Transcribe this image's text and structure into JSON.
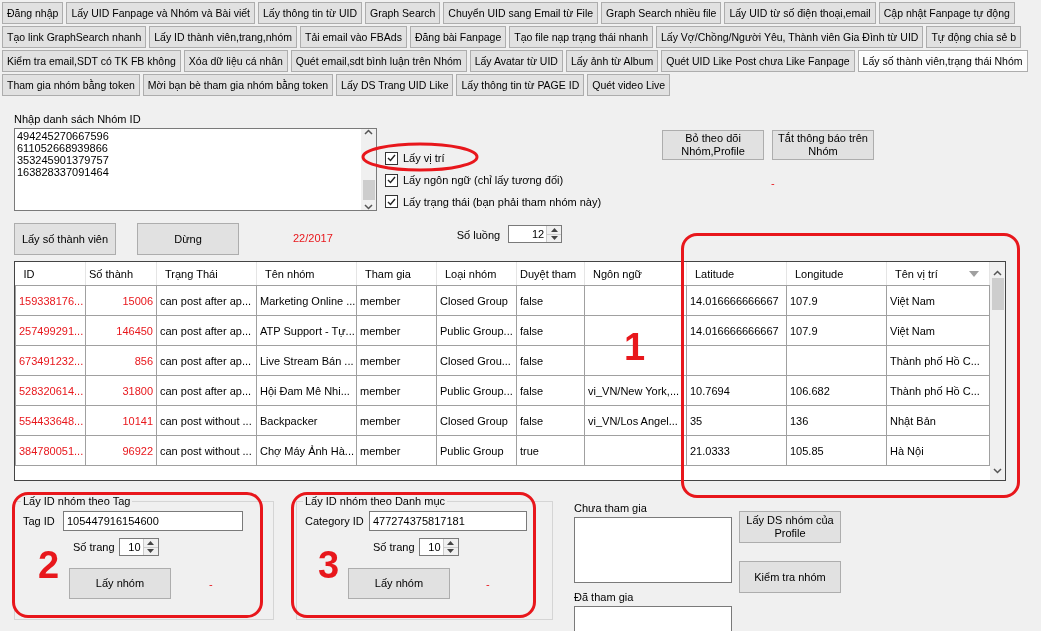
{
  "tab_rows": [
    [
      {
        "label": "Đăng nhập",
        "selected": false
      },
      {
        "label": "Lấy UID Fanpage và Nhóm và Bài viết",
        "selected": false
      },
      {
        "label": "Lấy thông tin từ UID",
        "selected": false
      },
      {
        "label": "Graph Search",
        "selected": false
      },
      {
        "label": "Chuyển UID sang Email từ File",
        "selected": false
      },
      {
        "label": "Graph Search nhiều file",
        "selected": false
      },
      {
        "label": "Lấy UID từ số điện thoại,email",
        "selected": false
      },
      {
        "label": "Cập nhật Fanpage tự động",
        "selected": false
      }
    ],
    [
      {
        "label": "Tạo link GraphSearch nhanh",
        "selected": false
      },
      {
        "label": "Lấy ID thành viên,trang,nhóm",
        "selected": false
      },
      {
        "label": "Tải email vào FBAds",
        "selected": false
      },
      {
        "label": "Đăng bài Fanpage",
        "selected": false
      },
      {
        "label": "Tạo file nạp trạng thái nhanh",
        "selected": false
      },
      {
        "label": "Lấy Vợ/Chồng/Người Yêu, Thành viên Gia Đình từ UID",
        "selected": false
      },
      {
        "label": "Tự động chia sẻ b",
        "selected": false
      }
    ],
    [
      {
        "label": "Kiểm tra email,SDT có TK FB không",
        "selected": false
      },
      {
        "label": "Xóa dữ liệu cá nhân",
        "selected": false
      },
      {
        "label": "Quét email,sdt bình luận trên Nhóm",
        "selected": false
      },
      {
        "label": "Lấy Avatar từ UID",
        "selected": false
      },
      {
        "label": "Lấy ảnh từ Album",
        "selected": false
      },
      {
        "label": "Quét UID Like Post chưa Like Fanpage",
        "selected": false
      },
      {
        "label": "Lấy số thành viên,trạng thái Nhóm",
        "selected": true
      }
    ],
    [
      {
        "label": "Tham gia nhóm bằng token",
        "selected": false
      },
      {
        "label": "Mời bạn bè tham gia nhóm bằng token",
        "selected": false
      },
      {
        "label": "Lấy DS Trang UID Like",
        "selected": false
      },
      {
        "label": "Lấy thông tin từ PAGE ID",
        "selected": false
      },
      {
        "label": "Quét video Live",
        "selected": false
      }
    ]
  ],
  "group_ids": {
    "label": "Nhập danh sách Nhóm ID",
    "lines": [
      "494245270667596",
      "611052668939866",
      "353245901379757",
      "163828337091464"
    ]
  },
  "options": [
    {
      "label": "Lấy vị trí",
      "checked": true
    },
    {
      "label": "Lấy ngôn ngữ (chỉ lấy tương đối)",
      "checked": true
    },
    {
      "label": "Lấy trạng thái (bạn phải tham nhóm này)",
      "checked": true
    }
  ],
  "side_buttons": [
    "Bỏ theo dõi Nhóm,Profile",
    "Tắt thông báo trên Nhóm"
  ],
  "side_status": "-",
  "actions": {
    "count_button": "Lấy số thành viên",
    "stop_button": "Dừng",
    "progress": "22/2017",
    "threads_label": "Số luồng",
    "threads": "12"
  },
  "table": {
    "columns": [
      {
        "label": "ID",
        "sorted": false
      },
      {
        "label": "Số thành",
        "sorted": false
      },
      {
        "label": "Trạng Thái",
        "sorted": false
      },
      {
        "label": "Tên nhóm",
        "sorted": false
      },
      {
        "label": "Tham gia",
        "sorted": false
      },
      {
        "label": "Loại nhóm",
        "sorted": false
      },
      {
        "label": "Duyệt tham",
        "sorted": false
      },
      {
        "label": "Ngôn ngữ",
        "sorted": false
      },
      {
        "label": "Latitude",
        "sorted": false
      },
      {
        "label": "Longitude",
        "sorted": false
      },
      {
        "label": "Tên vị trí",
        "sorted": true
      }
    ],
    "rows": [
      [
        "159338176...",
        "15006",
        "can post after ap...",
        "Marketing Online ...",
        "member",
        "Closed Group",
        "false",
        "",
        "14.016666666667",
        "107.9",
        "Việt Nam"
      ],
      [
        "257499291...",
        "146450",
        "can post after ap...",
        "ATP Support - Tự...",
        "member",
        "Public Group...",
        "false",
        "",
        "14.016666666667",
        "107.9",
        "Việt Nam"
      ],
      [
        "673491232...",
        "856",
        "can post after ap...",
        "Live Stream Bán ...",
        "member",
        "Closed Grou...",
        "false",
        "",
        "",
        "",
        "Thành phố Hồ C..."
      ],
      [
        "528320614...",
        "31800",
        "can post after ap...",
        "Hội  Đam Mê Nhi...",
        "member",
        "Public Group...",
        "false",
        "vi_VN/New York,...",
        "10.7694",
        "106.682",
        "Thành phố Hồ C..."
      ],
      [
        "554433648...",
        "10141",
        "can post without ...",
        "Backpacker",
        "member",
        "Closed Group",
        "false",
        "vi_VN/Los Angel...",
        "35",
        "136",
        "Nhật Bản"
      ],
      [
        "384780051...",
        "96922",
        "can post without ...",
        "Chợ Máy Ảnh Hà...",
        "member",
        "Public Group",
        "true",
        "",
        "21.0333",
        "105.85",
        "Hà Nội"
      ]
    ]
  },
  "tag_group": {
    "title": "Lấy ID nhóm theo Tag",
    "field_label": "Tag ID",
    "value": "105447916154600",
    "pages_label": "Số trang",
    "pages": "10",
    "button": "Lấy nhóm",
    "status": "-"
  },
  "category_group": {
    "title": "Lấy ID nhóm theo Danh mục",
    "field_label": "Category ID",
    "value": "477274375817181",
    "pages_label": "Số trang",
    "pages": "10",
    "button": "Lấy nhóm",
    "status": "-"
  },
  "not_joined": {
    "label": "Chưa tham gia"
  },
  "joined": {
    "label": "Đã tham gia"
  },
  "profile_buttons": [
    "Lấy DS nhóm của Profile",
    "Kiểm tra nhóm"
  ],
  "annotations": [
    {
      "kind": "ellipse"
    },
    {
      "kind": "box",
      "number": "1"
    },
    {
      "kind": "box",
      "number": "2"
    },
    {
      "kind": "box",
      "number": "3"
    }
  ]
}
